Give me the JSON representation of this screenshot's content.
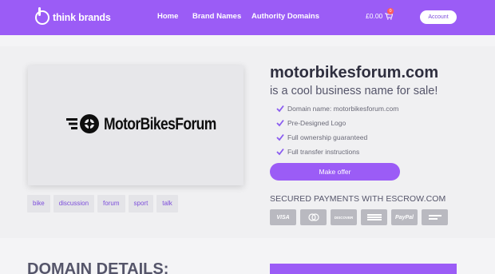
{
  "header": {
    "logo_text": "think brands",
    "nav": [
      "Home",
      "Brand Names",
      "Authority Domains"
    ],
    "cart_amount": "£0.00",
    "cart_count": "0",
    "account_label": "Account"
  },
  "listing": {
    "logo_brand_text": "MotorBikesForum",
    "domain": "motorbikesforum.com",
    "sale_line": "is a cool business name for sale!",
    "features": [
      "Domain name: motorbikesforum.com",
      "Pre-Designed Logo",
      "Full ownership guaranteed",
      "Full transfer instructions"
    ],
    "offer_label": "Make offer",
    "secured_text": "SECURED PAYMENTS WITH ESCROW.COM",
    "payment_icons": [
      "visa-icon",
      "mastercard-icon",
      "discover-icon",
      "amex-icon",
      "paypal-icon",
      "bank-transfer-icon"
    ],
    "payment_labels": [
      "VISA",
      "",
      "DISCOVER",
      "",
      "PayPal",
      ""
    ],
    "tags": [
      "bike",
      "discussion",
      "forum",
      "sport",
      "talk"
    ]
  },
  "details": {
    "heading": "DOMAIN DETAILS:"
  },
  "colors": {
    "brand": "#9b5cf6",
    "check": "#8a5cf0",
    "page_bg": "#f4f4f6"
  }
}
